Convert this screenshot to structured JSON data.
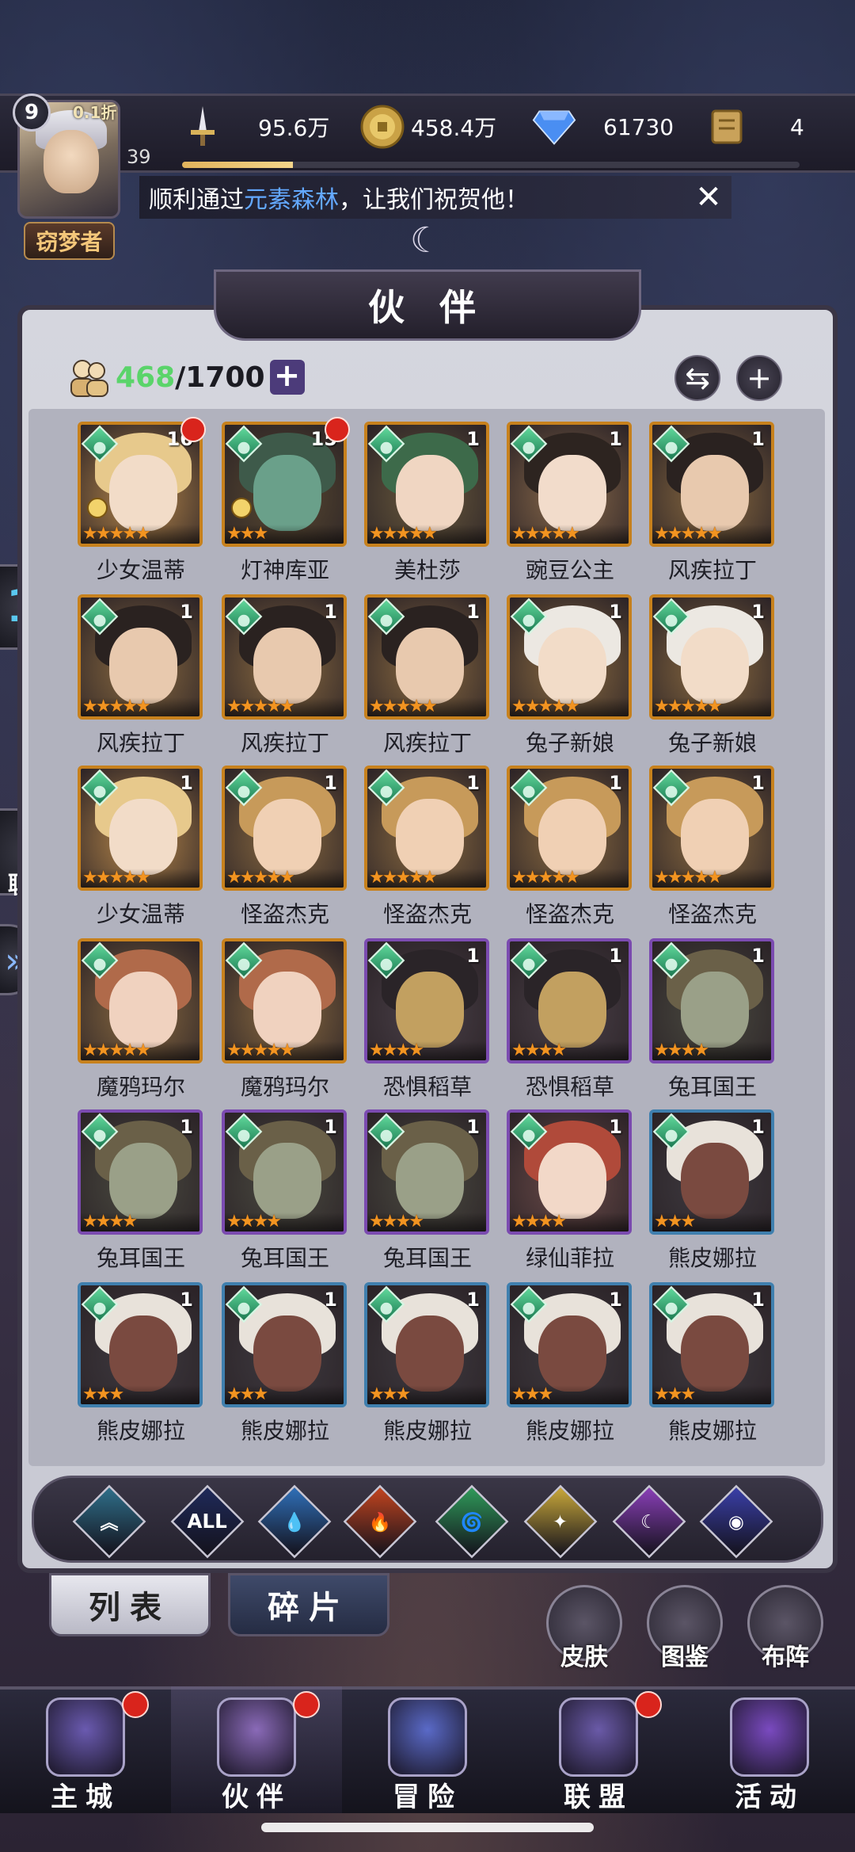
{
  "player": {
    "level": "9",
    "vip_discount": "0.1折",
    "exp_number": "39",
    "title": "窃梦者"
  },
  "resources": [
    {
      "icon": "sword-icon",
      "value": "95.6万"
    },
    {
      "icon": "gold-coin-icon",
      "value": "458.4万"
    },
    {
      "icon": "diamond-icon",
      "value": "61730"
    },
    {
      "icon": "scroll-icon",
      "value": "4"
    }
  ],
  "exp_progress": 0.18,
  "notice": {
    "prefix": "顺利通过",
    "highlight": "元素森林",
    "suffix": "，让我们祝贺他！"
  },
  "side": {
    "chat_label": "聊 天"
  },
  "panel": {
    "title": "伙 伴",
    "count_current": "468",
    "count_max": "/1700",
    "plus": "+"
  },
  "heroes": [
    {
      "name": "少女温蒂",
      "level": "16",
      "stars": 5,
      "red_dot": true,
      "gear": true,
      "frame": "gold",
      "palette": [
        "#b8884a",
        "#e7c98c",
        "#f2dcc8"
      ]
    },
    {
      "name": "灯神库亚",
      "level": "15",
      "stars": 3,
      "red_dot": true,
      "gear": true,
      "frame": "gold",
      "palette": [
        "#5a4a30",
        "#3e5a4a",
        "#6aa08a"
      ]
    },
    {
      "name": "美杜莎",
      "level": "1",
      "stars": 5,
      "red_dot": false,
      "gear": false,
      "frame": "gold",
      "palette": [
        "#6a5a3c",
        "#3d6a4a",
        "#f0d6c2"
      ]
    },
    {
      "name": "豌豆公主",
      "level": "1",
      "stars": 5,
      "red_dot": false,
      "gear": false,
      "frame": "gold",
      "palette": [
        "#8a6a4a",
        "#2d2420",
        "#f2dccb"
      ]
    },
    {
      "name": "风疾拉丁",
      "level": "1",
      "stars": 5,
      "red_dot": false,
      "gear": false,
      "frame": "gold",
      "palette": [
        "#8a6a40",
        "#2a2220",
        "#e8c9ae"
      ]
    },
    {
      "name": "风疾拉丁",
      "level": "1",
      "stars": 5,
      "red_dot": false,
      "gear": false,
      "frame": "gold",
      "palette": [
        "#8a6a40",
        "#2a2220",
        "#e8c9ae"
      ]
    },
    {
      "name": "风疾拉丁",
      "level": "1",
      "stars": 5,
      "red_dot": false,
      "gear": false,
      "frame": "gold",
      "palette": [
        "#8a6a40",
        "#2a2220",
        "#e8c9ae"
      ]
    },
    {
      "name": "风疾拉丁",
      "level": "1",
      "stars": 5,
      "red_dot": false,
      "gear": false,
      "frame": "gold",
      "palette": [
        "#8a6a40",
        "#2a2220",
        "#e8c9ae"
      ]
    },
    {
      "name": "兔子新娘",
      "level": "1",
      "stars": 5,
      "red_dot": false,
      "gear": false,
      "frame": "gold",
      "palette": [
        "#8a6a40",
        "#ece8e2",
        "#f2dcc8"
      ]
    },
    {
      "name": "兔子新娘",
      "level": "1",
      "stars": 5,
      "red_dot": false,
      "gear": false,
      "frame": "gold",
      "palette": [
        "#8a6a40",
        "#ece8e2",
        "#f2dcc8"
      ]
    },
    {
      "name": "少女温蒂",
      "level": "1",
      "stars": 5,
      "red_dot": false,
      "gear": false,
      "frame": "gold",
      "palette": [
        "#b8884a",
        "#e7c98c",
        "#f2dcc8"
      ]
    },
    {
      "name": "怪盗杰克",
      "level": "1",
      "stars": 5,
      "red_dot": false,
      "gear": false,
      "frame": "gold",
      "palette": [
        "#8a6a40",
        "#c79a5a",
        "#f0d0b4"
      ]
    },
    {
      "name": "怪盗杰克",
      "level": "1",
      "stars": 5,
      "red_dot": false,
      "gear": false,
      "frame": "gold",
      "palette": [
        "#8a6a40",
        "#c79a5a",
        "#f0d0b4"
      ]
    },
    {
      "name": "怪盗杰克",
      "level": "1",
      "stars": 5,
      "red_dot": false,
      "gear": false,
      "frame": "gold",
      "palette": [
        "#8a6a40",
        "#c79a5a",
        "#f0d0b4"
      ]
    },
    {
      "name": "怪盗杰克",
      "level": "1",
      "stars": 5,
      "red_dot": false,
      "gear": false,
      "frame": "gold",
      "palette": [
        "#8a6a40",
        "#c79a5a",
        "#f0d0b4"
      ]
    },
    {
      "name": "魔鸦玛尔",
      "level": "",
      "stars": 5,
      "red_dot": false,
      "gear": false,
      "frame": "gold",
      "palette": [
        "#8a6a40",
        "#b06a4a",
        "#f0d2bf"
      ]
    },
    {
      "name": "魔鸦玛尔",
      "level": "",
      "stars": 5,
      "red_dot": false,
      "gear": false,
      "frame": "gold",
      "palette": [
        "#8a6a40",
        "#b06a4a",
        "#f0d2bf"
      ]
    },
    {
      "name": "恐惧稻草",
      "level": "1",
      "stars": 4,
      "red_dot": false,
      "gear": false,
      "frame": "purple",
      "palette": [
        "#4a4048",
        "#2a2428",
        "#c2a060"
      ]
    },
    {
      "name": "恐惧稻草",
      "level": "1",
      "stars": 4,
      "red_dot": false,
      "gear": false,
      "frame": "purple",
      "palette": [
        "#4a4048",
        "#2a2428",
        "#c2a060"
      ]
    },
    {
      "name": "兔耳国王",
      "level": "1",
      "stars": 4,
      "red_dot": false,
      "gear": false,
      "frame": "purple",
      "palette": [
        "#4a4a40",
        "#6a6048",
        "#9aa088"
      ]
    },
    {
      "name": "兔耳国王",
      "level": "1",
      "stars": 4,
      "red_dot": false,
      "gear": false,
      "frame": "purple",
      "palette": [
        "#4a4a40",
        "#6a6048",
        "#9aa088"
      ]
    },
    {
      "name": "兔耳国王",
      "level": "1",
      "stars": 4,
      "red_dot": false,
      "gear": false,
      "frame": "purple",
      "palette": [
        "#4a4a40",
        "#6a6048",
        "#9aa088"
      ]
    },
    {
      "name": "兔耳国王",
      "level": "1",
      "stars": 4,
      "red_dot": false,
      "gear": false,
      "frame": "purple",
      "palette": [
        "#4a4a40",
        "#6a6048",
        "#9aa088"
      ]
    },
    {
      "name": "绿仙菲拉",
      "level": "1",
      "stars": 4,
      "red_dot": false,
      "gear": false,
      "frame": "purple",
      "palette": [
        "#6a4a48",
        "#b04a3a",
        "#f2d8c8"
      ]
    },
    {
      "name": "熊皮娜拉",
      "level": "1",
      "stars": 3,
      "red_dot": false,
      "gear": false,
      "frame": "blue",
      "palette": [
        "#3e3a40",
        "#e8e2da",
        "#7a4a40"
      ]
    },
    {
      "name": "熊皮娜拉",
      "level": "1",
      "stars": 3,
      "red_dot": false,
      "gear": false,
      "frame": "blue",
      "palette": [
        "#3e3a40",
        "#e8e2da",
        "#7a4a40"
      ]
    },
    {
      "name": "熊皮娜拉",
      "level": "1",
      "stars": 3,
      "red_dot": false,
      "gear": false,
      "frame": "blue",
      "palette": [
        "#3e3a40",
        "#e8e2da",
        "#7a4a40"
      ]
    },
    {
      "name": "熊皮娜拉",
      "level": "1",
      "stars": 3,
      "red_dot": false,
      "gear": false,
      "frame": "blue",
      "palette": [
        "#3e3a40",
        "#e8e2da",
        "#7a4a40"
      ]
    },
    {
      "name": "熊皮娜拉",
      "level": "1",
      "stars": 3,
      "red_dot": false,
      "gear": false,
      "frame": "blue",
      "palette": [
        "#3e3a40",
        "#e8e2da",
        "#7a4a40"
      ]
    },
    {
      "name": "熊皮娜拉",
      "level": "1",
      "stars": 3,
      "red_dot": false,
      "gear": false,
      "frame": "blue",
      "palette": [
        "#3e3a40",
        "#e8e2da",
        "#7a4a40"
      ]
    }
  ],
  "filters": [
    {
      "name": "filter-defense",
      "label": "",
      "color": "#2f6f8a",
      "glyph": "︽"
    },
    {
      "name": "filter-all",
      "label": "ALL",
      "color": "#1f2a5a",
      "glyph": ""
    },
    {
      "name": "filter-water",
      "label": "",
      "color": "#2f6fb8",
      "glyph": "💧"
    },
    {
      "name": "filter-fire",
      "label": "",
      "color": "#c2441f",
      "glyph": "🔥"
    },
    {
      "name": "filter-wind",
      "label": "",
      "color": "#2f9a5a",
      "glyph": "🌀"
    },
    {
      "name": "filter-light",
      "label": "",
      "color": "#c9a83a",
      "glyph": "✦"
    },
    {
      "name": "filter-dark",
      "label": "",
      "color": "#8a3fb8",
      "glyph": "☾"
    },
    {
      "name": "filter-star",
      "label": "",
      "color": "#3a3fa8",
      "glyph": "◉"
    }
  ],
  "tabs": {
    "list": "列表",
    "shards": "碎片"
  },
  "tools": [
    {
      "name": "skin-button",
      "label": "皮肤"
    },
    {
      "name": "codex-button",
      "label": "图鉴"
    },
    {
      "name": "formation-button",
      "label": "布阵"
    }
  ],
  "nav": [
    {
      "name": "nav-main-city",
      "label": "主城",
      "red_dot": true,
      "color": "#6a5ab0"
    },
    {
      "name": "nav-partners",
      "label": "伙伴",
      "red_dot": true,
      "color": "#8a6ab8"
    },
    {
      "name": "nav-adventure",
      "label": "冒险",
      "red_dot": false,
      "color": "#5a6ac8"
    },
    {
      "name": "nav-alliance",
      "label": "联盟",
      "red_dot": true,
      "color": "#6a5aa8"
    },
    {
      "name": "nav-events",
      "label": "活动",
      "red_dot": false,
      "color": "#7a4ac0"
    }
  ]
}
